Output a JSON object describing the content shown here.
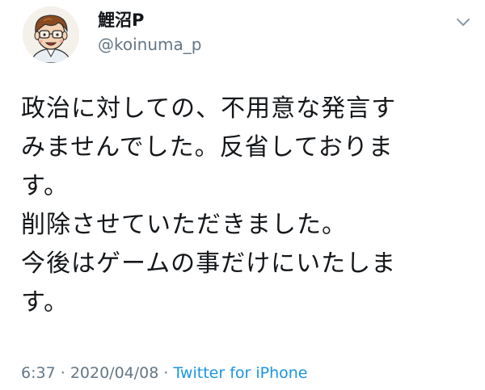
{
  "tweet": {
    "display_name": "鯉沼P",
    "handle": "@koinuma_p",
    "text": "政治に対しての、不用意な発言す\nみませんでした。反省しておりま\nす。\n削除させていただきました。\n今後はゲームの事だけにいたしま\nす。",
    "time": "6:37",
    "separator": "·",
    "date": "2020/04/08",
    "source": "Twitter for iPhone"
  },
  "icons": {
    "avatar": "cartoon-avatar",
    "menu": "chevron-down-icon"
  },
  "colors": {
    "text": "#14171a",
    "secondary": "#657786",
    "link": "#1b95e0"
  }
}
